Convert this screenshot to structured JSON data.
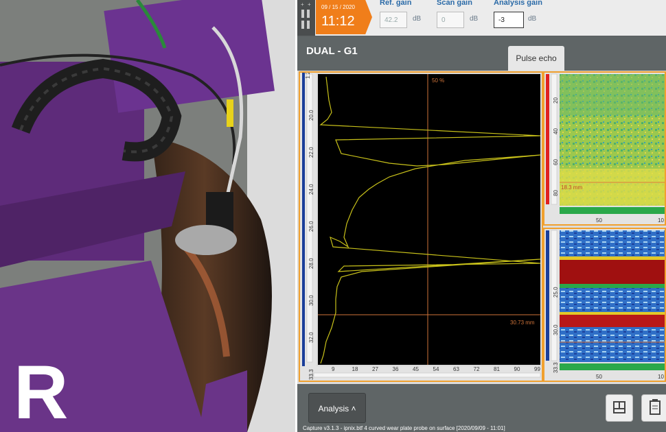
{
  "photo": {
    "stamp_label": "R"
  },
  "header": {
    "date": "09 / 15 / 2020",
    "time": "11:12",
    "ref_gain_label": "Ref. gain",
    "ref_gain_value": "42.2",
    "ref_gain_unit": "dB",
    "scan_gain_label": "Scan gain",
    "scan_gain_value": "0",
    "scan_gain_unit": "dB",
    "analysis_gain_label": "Analysis gain",
    "analysis_gain_value": "-3",
    "analysis_gain_unit": "dB"
  },
  "mode": {
    "title": "DUAL - G1",
    "tab": "Pulse echo"
  },
  "ascan": {
    "gate_label": "50 %",
    "cursor_label": "30.73 mm",
    "y_ticks": [
      "20.0",
      "22.0",
      "24.0",
      "26.0",
      "28.0",
      "30.0",
      "32.0",
      "33.3"
    ],
    "y_top": "1.2",
    "x_ticks": [
      "9",
      "18",
      "27",
      "36",
      "45",
      "54",
      "63",
      "72",
      "81",
      "90",
      "99"
    ],
    "colors": {
      "trace": "#c9c21a",
      "cursor": "#d0743a",
      "background": "#000000"
    }
  },
  "cscan": {
    "y_ticks": [
      "20",
      "40",
      "60",
      "80"
    ],
    "label": "18.3 mm",
    "x_ticks": [
      "50",
      "10"
    ]
  },
  "bscan": {
    "y_ticks": [
      "25.0",
      "30.0",
      "33.3"
    ],
    "x_ticks": [
      "50",
      "10"
    ]
  },
  "footer": {
    "analysis_button": "Analysis",
    "status": "Capture v3.1.3 - ipnix.btf  4 curved wear plate probe on surface [2020/09/09 - 11:01]"
  }
}
